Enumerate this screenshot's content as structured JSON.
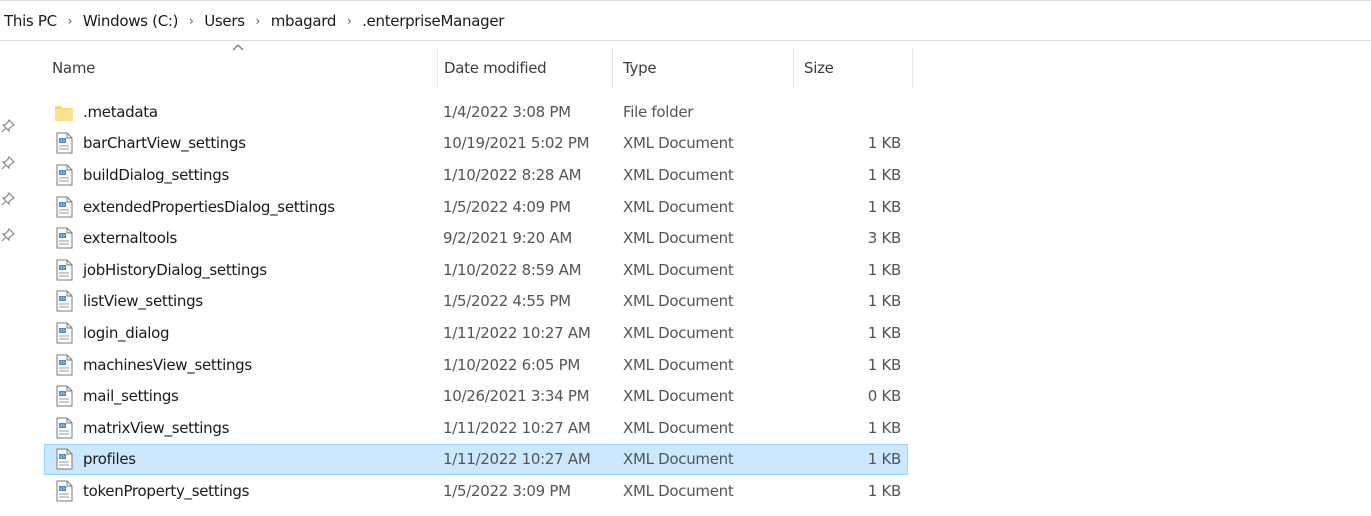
{
  "breadcrumb": [
    "This PC",
    "Windows (C:)",
    "Users",
    "mbagard",
    ".enterpriseManager"
  ],
  "columns": {
    "name": "Name",
    "date": "Date modified",
    "type": "Type",
    "size": "Size"
  },
  "sort": {
    "column": "name",
    "direction": "ascending"
  },
  "files": [
    {
      "name": ".metadata",
      "date": "1/4/2022 3:08 PM",
      "type": "File folder",
      "size": "",
      "icon": "folder-icon"
    },
    {
      "name": "barChartView_settings",
      "date": "10/19/2021 5:02 PM",
      "type": "XML Document",
      "size": "1 KB",
      "icon": "xml-document-icon"
    },
    {
      "name": "buildDialog_settings",
      "date": "1/10/2022 8:28 AM",
      "type": "XML Document",
      "size": "1 KB",
      "icon": "xml-document-icon"
    },
    {
      "name": "extendedPropertiesDialog_settings",
      "date": "1/5/2022 4:09 PM",
      "type": "XML Document",
      "size": "1 KB",
      "icon": "xml-document-icon"
    },
    {
      "name": "externaltools",
      "date": "9/2/2021 9:20 AM",
      "type": "XML Document",
      "size": "3 KB",
      "icon": "xml-document-icon"
    },
    {
      "name": "jobHistoryDialog_settings",
      "date": "1/10/2022 8:59 AM",
      "type": "XML Document",
      "size": "1 KB",
      "icon": "xml-document-icon"
    },
    {
      "name": "listView_settings",
      "date": "1/5/2022 4:55 PM",
      "type": "XML Document",
      "size": "1 KB",
      "icon": "xml-document-icon"
    },
    {
      "name": "login_dialog",
      "date": "1/11/2022 10:27 AM",
      "type": "XML Document",
      "size": "1 KB",
      "icon": "xml-document-icon"
    },
    {
      "name": "machinesView_settings",
      "date": "1/10/2022 6:05 PM",
      "type": "XML Document",
      "size": "1 KB",
      "icon": "xml-document-icon"
    },
    {
      "name": "mail_settings",
      "date": "10/26/2021 3:34 PM",
      "type": "XML Document",
      "size": "0 KB",
      "icon": "xml-document-icon"
    },
    {
      "name": "matrixView_settings",
      "date": "1/11/2022 10:27 AM",
      "type": "XML Document",
      "size": "1 KB",
      "icon": "xml-document-icon"
    },
    {
      "name": "profiles",
      "date": "1/11/2022 10:27 AM",
      "type": "XML Document",
      "size": "1 KB",
      "icon": "xml-document-icon",
      "selected": true
    },
    {
      "name": "tokenProperty_settings",
      "date": "1/5/2022 3:09 PM",
      "type": "XML Document",
      "size": "1 KB",
      "icon": "xml-document-icon"
    }
  ],
  "colors": {
    "selection_bg": "#cce8ff",
    "selection_border": "#99d1ff",
    "folder": "#f8d775"
  }
}
